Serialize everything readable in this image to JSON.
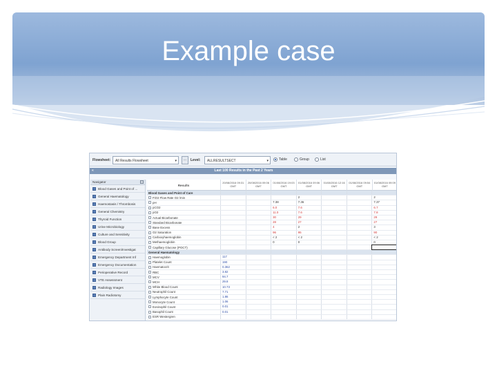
{
  "slide": {
    "title": "Example case"
  },
  "toolbar": {
    "flowsheet_label": "Flowsheet:",
    "flowsheet_value": "All Results Flowsheet",
    "level_label": "Level:",
    "level_value": "ALLRESULTSECT",
    "ellipsis": "...",
    "view_options": [
      {
        "label": "Table",
        "selected": true
      },
      {
        "label": "Group",
        "selected": false
      },
      {
        "label": "List",
        "selected": false
      }
    ]
  },
  "header": {
    "text": "Last 100 Results in the Past 2 Years",
    "collapse": "«"
  },
  "navigator": {
    "title": "Navigator",
    "items": [
      "Blood Gases and Point of ...",
      "General Haematology",
      "Haemostasis / Thrombosis",
      "General Chemistry",
      "Thyroid Function",
      "Urine Microbiology",
      "Culture and Sensitivity",
      "Blood Group",
      "Antibody Screen/Investigat",
      "Emergency Department Inf",
      "Emergency Documentation",
      "Perioperative Record",
      "VTE Assessment",
      "Radiology Images",
      "Plain Radiotomy"
    ]
  },
  "grid": {
    "results_header": "Results",
    "columns": [
      "20/08/2016 09:31 GMT",
      "20/08/2016 09:06 GMT",
      "01/08/2016 19:03 GMT",
      "01/08/2016 09:06 GMT",
      "01/08/2016 12:16 GMT",
      "01/08/2016 09:54 GMT",
      "01/08/2016 09:09 GMT"
    ],
    "rows": [
      {
        "name": "Blood Gases and Point of Care",
        "section": true,
        "cells": [
          "",
          "",
          "",
          "",
          "",
          "",
          ""
        ]
      },
      {
        "name": "FiO2 Flow Rate O2 /min",
        "cells": [
          "",
          "",
          "",
          "2",
          "",
          "",
          "2"
        ]
      },
      {
        "name": "pH",
        "cells": [
          "",
          "",
          "7.38",
          "7.36",
          "",
          "",
          "7.37"
        ]
      },
      {
        "name": "pCO2",
        "cells": [
          "",
          "",
          "6.0",
          "7.6",
          "",
          "",
          "6.7"
        ]
      },
      {
        "name": "pO2",
        "cells": [
          "",
          "",
          "11.0",
          "7.6",
          "",
          "",
          "7.8"
        ]
      },
      {
        "name": "Actual Bicarbonate",
        "cells": [
          "",
          "",
          "30",
          "29",
          "",
          "",
          "29"
        ]
      },
      {
        "name": "Standard Bicarbonate",
        "cells": [
          "",
          "",
          "28",
          "27",
          "",
          "",
          "27"
        ]
      },
      {
        "name": "Base Excess",
        "cells": [
          "",
          "",
          "4",
          "2",
          "",
          "",
          "3"
        ]
      },
      {
        "name": "O2 Saturation",
        "cells": [
          "",
          "",
          "96",
          "95",
          "",
          "",
          "90"
        ]
      },
      {
        "name": "Carboxyhaemoglobin",
        "cells": [
          "",
          "",
          "< 2",
          "< 2",
          "",
          "",
          "< 2"
        ]
      },
      {
        "name": "Methaemoglobin",
        "cells": [
          "",
          "",
          "0",
          "0",
          "",
          "",
          "0"
        ]
      },
      {
        "name": "Capillary Glucose (POCT)",
        "cells": [
          "",
          "",
          "",
          "",
          "",
          "",
          ""
        ]
      },
      {
        "name": "General Haematology",
        "section": true,
        "cells": [
          "",
          "",
          "",
          "",
          "",
          "",
          ""
        ]
      },
      {
        "name": "Haemoglobin",
        "cells": [
          "117",
          "",
          "",
          "",
          "",
          "",
          ""
        ]
      },
      {
        "name": "Platelet Count",
        "cells": [
          "190",
          "",
          "",
          "",
          "",
          "",
          ""
        ]
      },
      {
        "name": "Haematocrit",
        "cells": [
          "0.362",
          "",
          "",
          "",
          "",
          "",
          ""
        ]
      },
      {
        "name": "RBC",
        "cells": [
          "3.82",
          "",
          "",
          "",
          "",
          "",
          ""
        ]
      },
      {
        "name": "MCV",
        "cells": [
          "94.7",
          "",
          "",
          "",
          "",
          "",
          ""
        ]
      },
      {
        "name": "MCH",
        "cells": [
          "29.8",
          "",
          "",
          "",
          "",
          "",
          ""
        ]
      },
      {
        "name": "White Blood Count",
        "cells": [
          "10.73",
          "",
          "",
          "",
          "",
          "",
          ""
        ]
      },
      {
        "name": "Neutrophil Count",
        "cells": [
          "7.71",
          "",
          "",
          "",
          "",
          "",
          ""
        ]
      },
      {
        "name": "Lymphocyte Count",
        "cells": [
          "1.86",
          "",
          "",
          "",
          "",
          "",
          ""
        ]
      },
      {
        "name": "Monocyte Count",
        "cells": [
          "1.06",
          "",
          "",
          "",
          "",
          "",
          ""
        ]
      },
      {
        "name": "Eosinophil Count",
        "cells": [
          "0.01",
          "",
          "",
          "",
          "",
          "",
          ""
        ]
      },
      {
        "name": "Basophil Count",
        "cells": [
          "0.01",
          "",
          "",
          "",
          "",
          "",
          ""
        ]
      },
      {
        "name": "ESR Westergren",
        "cells": [
          "",
          "",
          "",
          "",
          "",
          "",
          ""
        ]
      }
    ]
  },
  "colors": {
    "band_top": "#9db9de",
    "band_bottom": "#6f95c8",
    "header_bar": "#7e97b8",
    "abnormal": "#d13b3b",
    "normal": "#2f4fa8"
  }
}
